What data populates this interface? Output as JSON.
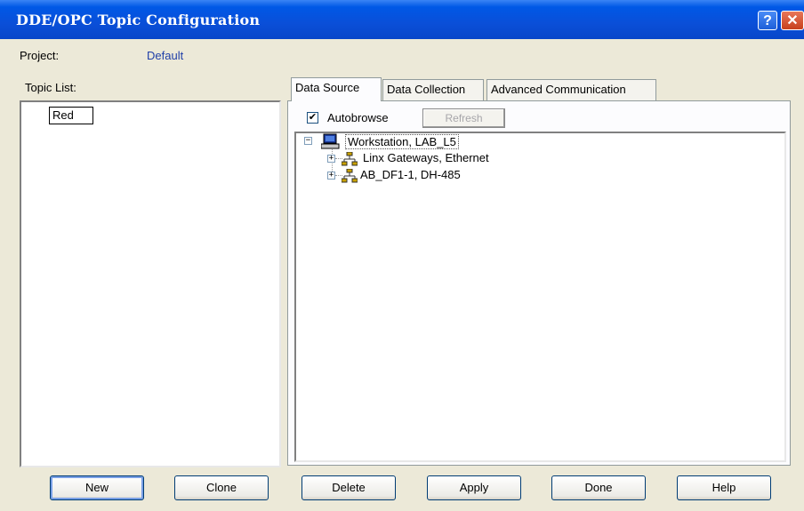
{
  "window": {
    "title": "DDE/OPC Topic Configuration",
    "help_glyph": "?",
    "close_glyph": "✕"
  },
  "project": {
    "label": "Project:",
    "value": "Default"
  },
  "topic_list": {
    "label": "Topic List:",
    "items": [
      "Red"
    ]
  },
  "tabs": [
    {
      "label": "Data Source",
      "active": true
    },
    {
      "label": "Data Collection",
      "active": false
    },
    {
      "label": "Advanced Communication",
      "active": false
    }
  ],
  "data_source": {
    "autobrowse": {
      "label": "Autobrowse",
      "checked": true,
      "check_glyph": "✔"
    },
    "refresh_label": "Refresh",
    "tree": {
      "root": {
        "label": "Workstation, LAB_L5",
        "expanded": true,
        "icon": "computer-icon"
      },
      "children": [
        {
          "label": "Linx Gateways, Ethernet",
          "expanded": false,
          "icon": "network-icon"
        },
        {
          "label": "AB_DF1-1, DH-485",
          "expanded": false,
          "icon": "network-icon"
        }
      ]
    }
  },
  "buttons": {
    "new": "New",
    "clone": "Clone",
    "delete": "Delete",
    "apply": "Apply",
    "done": "Done",
    "help": "Help"
  },
  "colors": {
    "titlebar": "#0a4fd8",
    "window_bg": "#ece9d8",
    "project_value": "#1f3fa8"
  }
}
